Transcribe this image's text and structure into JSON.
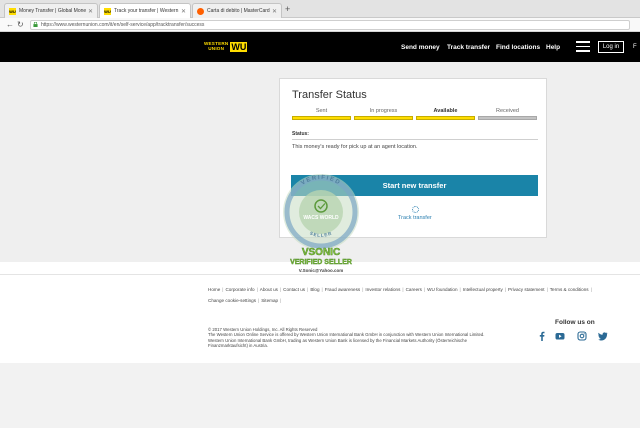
{
  "browser": {
    "tabs": [
      {
        "title": "Money Transfer | Global Money",
        "active": false,
        "favicon": "wu-favicon"
      },
      {
        "title": "Track your transfer | Western U",
        "active": true,
        "favicon": "wu-favicon"
      },
      {
        "title": "Carta di debito | MasterCard",
        "active": false,
        "favicon": "mastercard-favicon"
      }
    ],
    "new_tab": "+",
    "url": "https://www.westernunion.com/it/en/self-service/app/tracktransfer/success"
  },
  "header": {
    "logo_top": "WESTERN",
    "logo_bottom": "UNION",
    "logo_mark": "WU",
    "nav": [
      "Send money",
      "Track transfer",
      "Find locations",
      "Help"
    ],
    "login": "Log in",
    "edge_text": "F"
  },
  "card": {
    "title": "Transfer Status",
    "steps": [
      {
        "label": "Sent",
        "complete": true,
        "bold": false
      },
      {
        "label": "In progress",
        "complete": true,
        "bold": false
      },
      {
        "label": "Available",
        "complete": true,
        "bold": true
      },
      {
        "label": "Received",
        "complete": false,
        "bold": false
      }
    ],
    "status_label": "Status:",
    "status_text": "This money's ready for pick up at an agent location.",
    "start_button": "Start new transfer",
    "track_link": "Track transfer"
  },
  "watermark": {
    "ring_top": "VERIFIED",
    "ring_middle": "WACS WORLD",
    "ring_bottom": "SELLER",
    "line1": "VSONIC",
    "line2": "VERIFIED SELLER",
    "line3": "V.Sonic@Yahoo.com"
  },
  "footer": {
    "links": [
      "Home",
      "Corporate info",
      "About us",
      "Contact us",
      "Blog",
      "Fraud awareness",
      "Investor relations",
      "Careers",
      "WU foundation",
      "Intellectual property",
      "Privacy statement",
      "Terms & conditions",
      "Change cookie-settings",
      "Sitemap"
    ],
    "legal": [
      "© 2017 Western Union Holdings, Inc. All Rights Reserved",
      "The Western Union Online Service is offered by Western Union International Bank GmbH in conjunction with Western Union International Limited.",
      "Western Union International Bank GmbH, trading as Western Union Bank is licensed by the Financial Markets Authority (Österreichische",
      "Finanzmarktaufsicht) in Austria."
    ],
    "follow_us": "Follow us on",
    "social": [
      "facebook-icon",
      "youtube-icon",
      "instagram-icon",
      "twitter-icon"
    ]
  },
  "colors": {
    "brand_yellow": "#ffdd00",
    "button_blue": "#1a84a8",
    "step_inactive": "#c3c3c3",
    "header_black": "#000000",
    "watermark_green": "#6db33f"
  }
}
